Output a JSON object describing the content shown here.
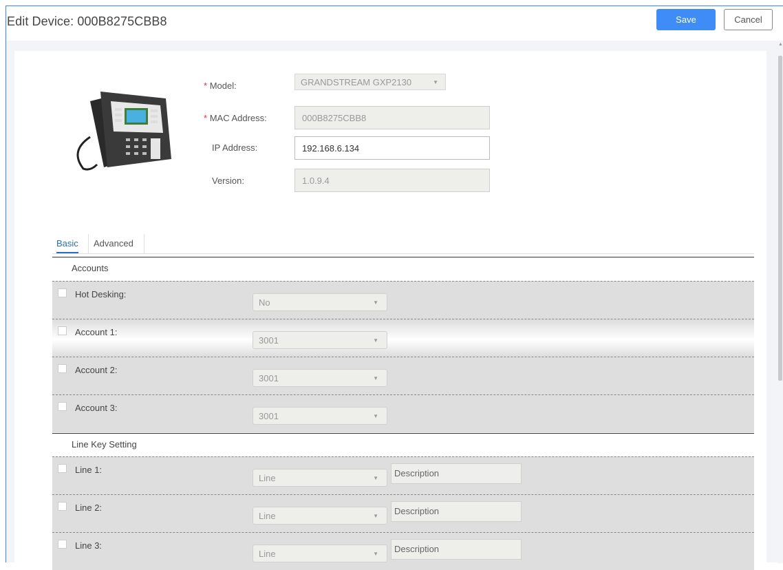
{
  "header": {
    "title": "Edit Device: 000B8275CBB8",
    "save_label": "Save",
    "cancel_label": "Cancel"
  },
  "device": {
    "model_label": "Model:",
    "model_value": "GRANDSTREAM GXP2130",
    "mac_label": "MAC Address:",
    "mac_value": "000B8275CBB8",
    "ip_label": "IP Address:",
    "ip_value": "192.168.6.134",
    "version_label": "Version:",
    "version_value": "1.0.9.4",
    "required_mark": "*"
  },
  "tabs": [
    {
      "label": "Basic"
    },
    {
      "label": "Advanced"
    }
  ],
  "accounts": {
    "heading": "Accounts",
    "rows": [
      {
        "label": "Hot Desking:",
        "value": "No"
      },
      {
        "label": "Account 1:",
        "value": "3001"
      },
      {
        "label": "Account 2:",
        "value": "3001"
      },
      {
        "label": "Account 3:",
        "value": "3001"
      }
    ]
  },
  "line_keys": {
    "heading": "Line Key Setting",
    "rows": [
      {
        "label": "Line 1:",
        "value": "Line",
        "description": "Description"
      },
      {
        "label": "Line 2:",
        "value": "Line",
        "description": "Description"
      },
      {
        "label": "Line 3:",
        "value": "Line",
        "description": "Description"
      }
    ]
  },
  "icons": {
    "dropdown": "▼",
    "scroll_up": "▲"
  }
}
